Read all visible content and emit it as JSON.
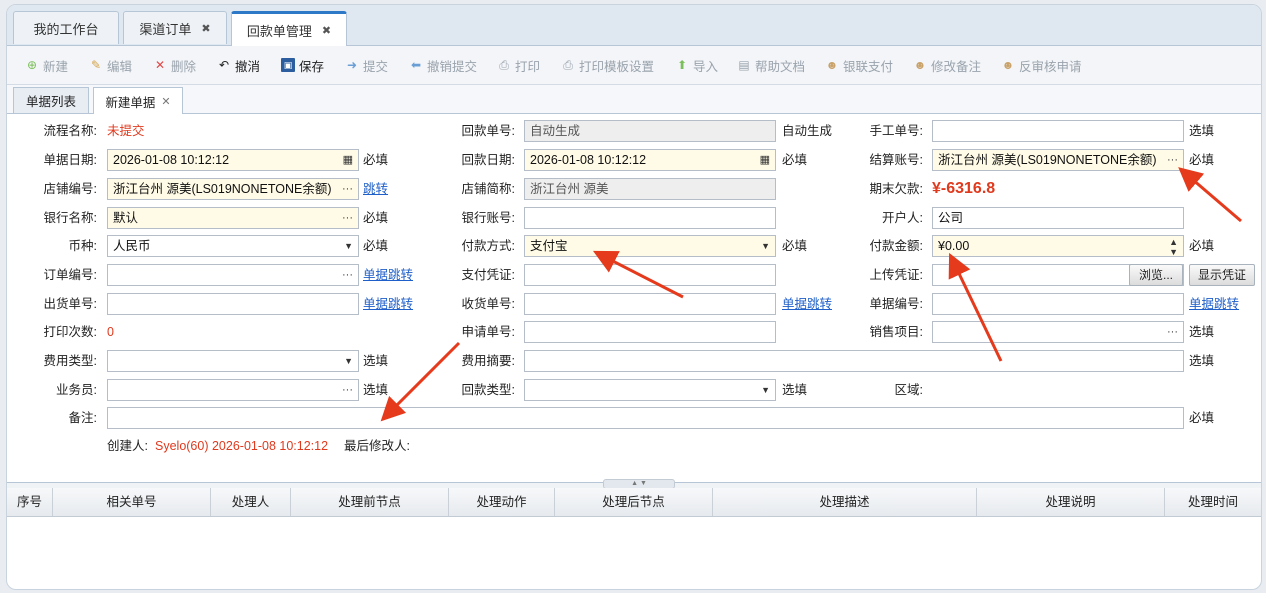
{
  "tabs": [
    {
      "label": "我的工作台",
      "closable": false
    },
    {
      "label": "渠道订单",
      "closable": true
    },
    {
      "label": "回款单管理",
      "closable": true,
      "active": true
    }
  ],
  "close_glyph": "✖",
  "toolbar": [
    {
      "label": "新建",
      "icon": "plus-icon",
      "enabled": false
    },
    {
      "label": "编辑",
      "icon": "pencil-icon",
      "enabled": false
    },
    {
      "label": "删除",
      "icon": "x-icon",
      "enabled": false
    },
    {
      "label": "撤消",
      "icon": "undo-icon",
      "enabled": true
    },
    {
      "label": "保存",
      "icon": "save-icon",
      "enabled": true
    },
    {
      "label": "提交",
      "icon": "arrow-right-icon",
      "enabled": false
    },
    {
      "label": "撤销提交",
      "icon": "arrow-left-icon",
      "enabled": false
    },
    {
      "label": "打印",
      "icon": "printer-icon",
      "enabled": false
    },
    {
      "label": "打印模板设置",
      "icon": "printer-settings-icon",
      "enabled": false
    },
    {
      "label": "导入",
      "icon": "up-arrow-icon",
      "enabled": false
    },
    {
      "label": "帮助文档",
      "icon": "doc-icon",
      "enabled": false
    },
    {
      "label": "银联支付",
      "icon": "user-icon",
      "enabled": false
    },
    {
      "label": "修改备注",
      "icon": "user-icon",
      "enabled": false
    },
    {
      "label": "反审核申请",
      "icon": "user-icon",
      "enabled": false
    }
  ],
  "subtabs": [
    {
      "label": "单据列表"
    },
    {
      "label": "新建单据",
      "closable": true
    }
  ],
  "subtab_close_glyph": "✕",
  "form": {
    "process_name_label": "流程名称:",
    "process_name_value": "未提交",
    "doc_date_label": "单据日期:",
    "doc_date_value": "2026-01-08 10:12:12",
    "store_code_label": "店铺编号:",
    "store_code_value": "浙江台州 源美(LS019NONETONE余额)",
    "bank_name_label": "银行名称:",
    "bank_name_value": "默认",
    "currency_label": "币种:",
    "currency_value": "人民币",
    "order_no_label": "订单编号:",
    "ship_no_label": "出货单号:",
    "print_count_label": "打印次数:",
    "print_count_value": "0",
    "fee_type_label": "费用类型:",
    "salesman_label": "业务员:",
    "remark_label": "备注:",
    "receipt_no_label": "回款单号:",
    "receipt_no_value": "自动生成",
    "receipt_date_label": "回款日期:",
    "receipt_date_value": "2026-01-08 10:12:12",
    "store_short_label": "店铺简称:",
    "store_short_value": "浙江台州 源美",
    "bank_account_label": "银行账号:",
    "pay_method_label": "付款方式:",
    "pay_method_value": "支付宝",
    "pay_voucher_label": "支付凭证:",
    "receive_no_label": "收货单号:",
    "apply_no_label": "申请单号:",
    "fee_summary_label": "费用摘要:",
    "receipt_type_label": "回款类型:",
    "manual_no_label": "手工单号:",
    "settle_account_label": "结算账号:",
    "settle_account_value": "浙江台州 源美(LS019NONETONE余额)",
    "period_debt_label": "期末欠款:",
    "period_debt_value": "¥-6316.8",
    "account_holder_label": "开户人:",
    "account_holder_value": "公司",
    "pay_amount_label": "付款金额:",
    "pay_amount_value": "¥0.00",
    "upload_voucher_label": "上传凭证:",
    "doc_no_label": "单据编号:",
    "sales_item_label": "销售项目:",
    "region_label": "区域:"
  },
  "notes": {
    "auto": "自动生成",
    "required": "必填",
    "optional": "选填",
    "jump": "跳转",
    "doc_jump": "单据跳转"
  },
  "buttons": {
    "browse": "浏览...",
    "show_voucher": "显示凭证"
  },
  "footer": {
    "creator_label": "创建人:",
    "creator_value": "Syelo(60) 2026-01-08 10:12:12",
    "modifier_label": "最后修改人:"
  },
  "grid_columns": [
    "序号",
    "相关单号",
    "处理人",
    "处理前节点",
    "处理动作",
    "处理后节点",
    "处理描述",
    "处理说明",
    "处理时间"
  ],
  "colors": {
    "accent": "#2d79c7",
    "required_bg": "#fffbe6",
    "warning_red": "#e03a1e",
    "link_blue": "#1f5fc9"
  }
}
